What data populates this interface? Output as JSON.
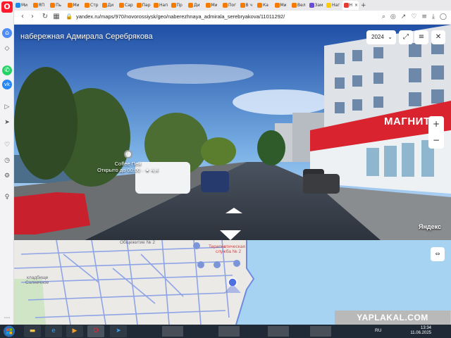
{
  "browser": {
    "tabs": [
      {
        "label": "Ми",
        "color": "#1e88e5"
      },
      {
        "label": "ЯП",
        "color": "#f57c00"
      },
      {
        "label": "Пь",
        "color": "#f57c00"
      },
      {
        "label": "Ми",
        "color": "#f57c00"
      },
      {
        "label": "Стр",
        "color": "#f57c00"
      },
      {
        "label": "Ди",
        "color": "#f57c00"
      },
      {
        "label": "Сар",
        "color": "#f57c00"
      },
      {
        "label": "Пар",
        "color": "#f57c00"
      },
      {
        "label": "Нап",
        "color": "#f57c00"
      },
      {
        "label": "Пр",
        "color": "#f57c00"
      },
      {
        "label": "Ди",
        "color": "#f57c00"
      },
      {
        "label": "Ми",
        "color": "#f57c00"
      },
      {
        "label": "Пог",
        "color": "#f57c00"
      },
      {
        "label": "В ч",
        "color": "#f57c00"
      },
      {
        "label": "Ка",
        "color": "#f57c00"
      },
      {
        "label": "Ми",
        "color": "#f57c00"
      },
      {
        "label": "Вел",
        "color": "#f57c00"
      },
      {
        "label": "Зам",
        "color": "#6a4bd6"
      },
      {
        "label": "Наг",
        "color": "#ffcc00"
      },
      {
        "label": "Н",
        "color": "#e53935",
        "active": true
      }
    ],
    "url": "yandex.ru/maps/970/novorossiysk/geo/naberezhnaya_admirala_serebryakova/11011292/"
  },
  "panorama": {
    "title": "набережная Адмирала Серебрякова",
    "year": "2024",
    "poi_name": "Coffee Пей",
    "poi_status": "Открыто до 00:00 · ★ 4,4",
    "store_sign": "МАГНИТ",
    "brand": "Яндекс",
    "zoom_in": "+",
    "zoom_out": "−"
  },
  "map": {
    "labels": {
      "l1": "Общежитие № 2",
      "l2": "Терапевтическая",
      "l3": "служба № 2",
      "l4": "кладбище",
      "l5": "Солнечное"
    },
    "watermark": "YAPLAKAL.COM"
  },
  "taskbar": {
    "lang": "RU",
    "time": "13:34",
    "date": "11.06.2025"
  },
  "colors": {
    "accent": "#e53935",
    "map_water": "#a7d3f2"
  }
}
